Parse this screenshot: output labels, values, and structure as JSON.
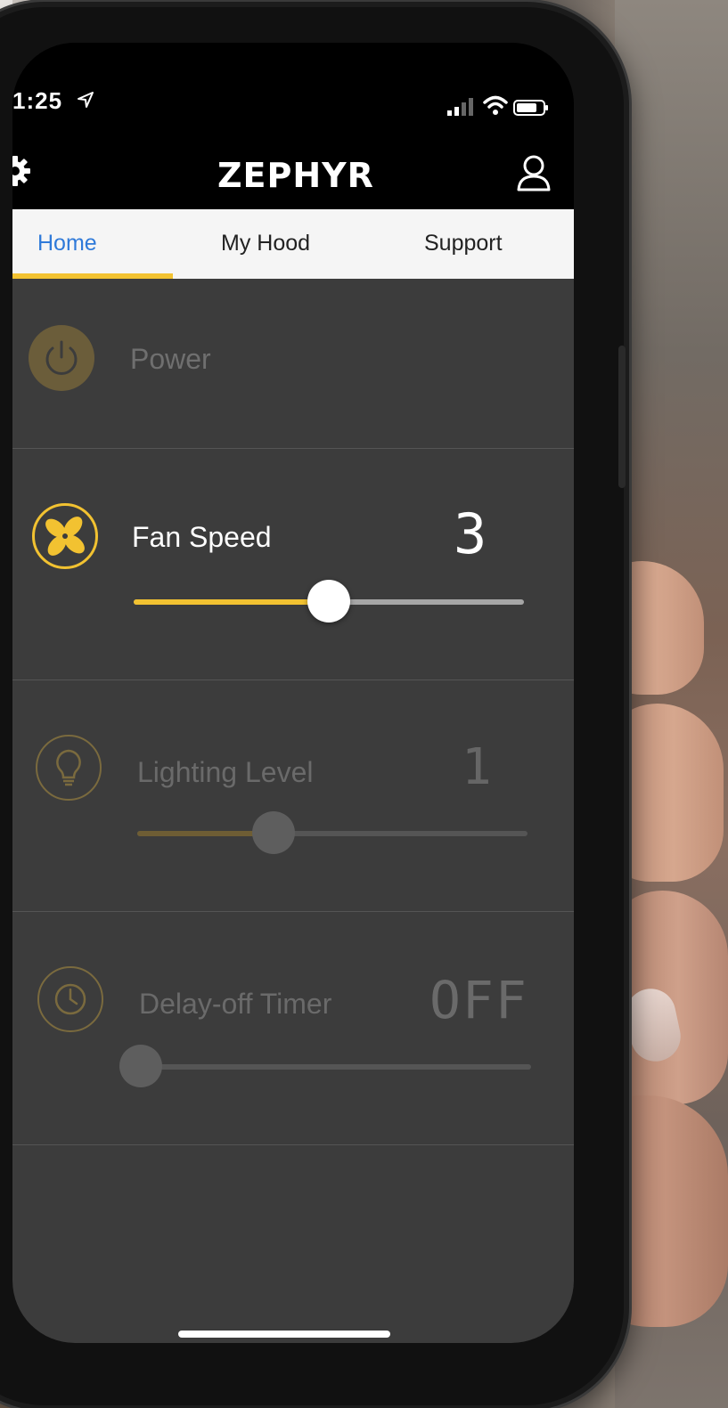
{
  "status_bar": {
    "time": "1:25"
  },
  "header": {
    "logo": "ZEPHYR"
  },
  "tabs": [
    {
      "label": "Home",
      "active": true
    },
    {
      "label": "My Hood",
      "active": false
    },
    {
      "label": "Support",
      "active": false
    }
  ],
  "controls": {
    "power": {
      "label": "Power",
      "enabled": false
    },
    "fan_speed": {
      "label": "Fan Speed",
      "value": "3",
      "level_fraction": 0.5,
      "enabled": true
    },
    "lighting_level": {
      "label": "Lighting Level",
      "value": "1",
      "level_fraction": 0.35,
      "enabled": false
    },
    "delay_off_timer": {
      "label": "Delay-off Timer",
      "value": "OFF",
      "level_fraction": 0.0,
      "enabled": false
    }
  },
  "colors": {
    "accent": "#f2c231",
    "tab_active": "#2f7ad9",
    "panel_bg": "#3c3c3c",
    "header_bg": "#000000",
    "tab_bar_bg": "#f5f5f5"
  },
  "icons": {
    "settings": "gear-icon",
    "account": "user-icon",
    "power": "power-icon",
    "fan": "fan-icon",
    "light": "lightbulb-icon",
    "timer": "clock-icon"
  }
}
